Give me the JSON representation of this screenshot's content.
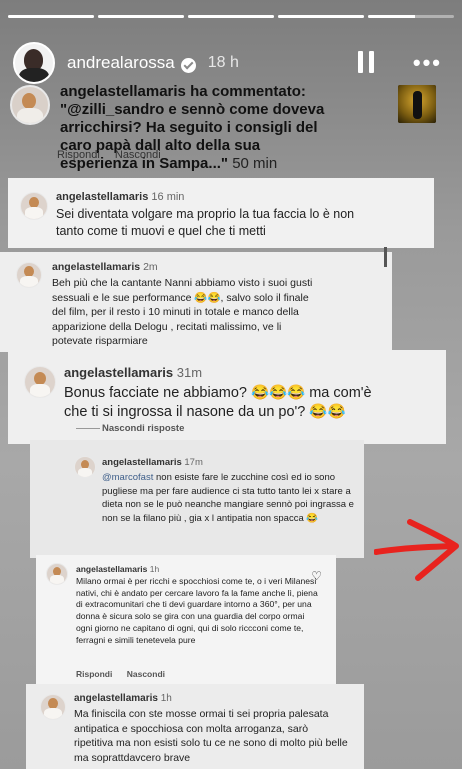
{
  "story": {
    "progress": [
      1,
      1,
      1,
      1,
      0.55
    ],
    "username": "andrealarossa",
    "time": "18 h",
    "icons": [
      "verified-badge-icon",
      "pause-icon",
      "more-icon"
    ]
  },
  "notification": {
    "user": "angelastellamaris",
    "action": "ha commentato:",
    "comment": "\"@zilli_sandro e sennò come doveva arricchirsi? Ha seguito i consigli del caro papà dall alto della sua esperienza in Sampa...\"",
    "time": "50 min",
    "peek_reply": "Rispondi",
    "peek_hide": "Nascondi"
  },
  "comments": [
    {
      "user": "angelastellamaris",
      "time": "16 min",
      "text": "Sei diventata volgare ma proprio la tua faccia lo è non tanto come ti muovi e quel che ti metti"
    },
    {
      "user": "angelastellamaris",
      "time": "2m",
      "text": "Beh più che la cantante Nanni abbiamo visto i suoi gusti sessuali e le sue performance 😂😂, salvo solo il finale del film, per il resto i 10 minuti in totale e manco della apparizione della Delogu , recitati malissimo, ve li potevate risparmiare"
    },
    {
      "user": "angelastellamaris",
      "time": "31m",
      "text": "Bonus facciate ne abbiamo? 😂😂😂 ma com'è che ti si ingrossa il nasone da un po'? 😂😂",
      "hide_replies": "Nascondi risposte"
    },
    {
      "user": "angelastellamaris",
      "time": "17m",
      "mention": "@marcofast",
      "text": " non esiste fare le zucchine così ed io sono pugliese ma per fare audience ci sta tutto tanto lei x stare a dieta non se le può neanche mangiare sennò poi ingrassa e non se la filano più , gia x l antipatia non spacca 😂"
    },
    {
      "user": "angelastellamaris",
      "time": "1h",
      "text": "Milano ormai è per ricchi e spocchiosi come te, o i veri Milanesi nativi, chi è andato per cercare lavoro fa la fame anche lì, piena di extracomunitari che ti devi guardare intorno a 360°, per una donna è sicura solo se gira con una guardia del corpo ormai ogni giorno ne capitano di ogni, qui di solo riccconi come te, ferragni e simili tenetevela pure",
      "reply": "Rispondi",
      "hide": "Nascondi"
    },
    {
      "user": "angelastellamaris",
      "time": "1h",
      "text": "Ma finiscila con ste mosse ormai ti sei propria palesata antipatica e spocchiosa con molta arroganza, sarò ripetitiva ma non esisti solo tu ce ne sono di molto più belle ma soprattdavcero brave"
    }
  ],
  "colors": {
    "arrow": "#e8231e",
    "background": "#9a9a9a",
    "card": "#f0f0f0"
  }
}
